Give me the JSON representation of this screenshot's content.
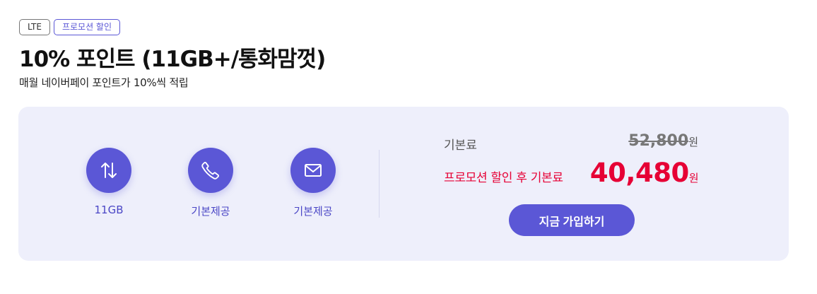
{
  "tags": [
    {
      "label": "LTE"
    },
    {
      "label": "프로모션 할인"
    }
  ],
  "plan": {
    "title": "10% 포인트 (11GB+/통화맘껏)",
    "subtitle": "매월 네이버페이 포인트가 10%씩 적립"
  },
  "features": [
    {
      "icon": "data-transfer-icon",
      "label": "11GB"
    },
    {
      "icon": "phone-icon",
      "label": "기본제공"
    },
    {
      "icon": "mail-icon",
      "label": "기본제공"
    }
  ],
  "pricing": {
    "base_label": "기본료",
    "base_price": "52,800",
    "promo_label": "프로모션 할인 후 기본료",
    "promo_price": "40,480",
    "unit": "원"
  },
  "cta": {
    "label": "지금 가입하기"
  },
  "colors": {
    "accent": "#5b57d6",
    "promo_red": "#e60035",
    "card_bg": "#eeeffb"
  }
}
